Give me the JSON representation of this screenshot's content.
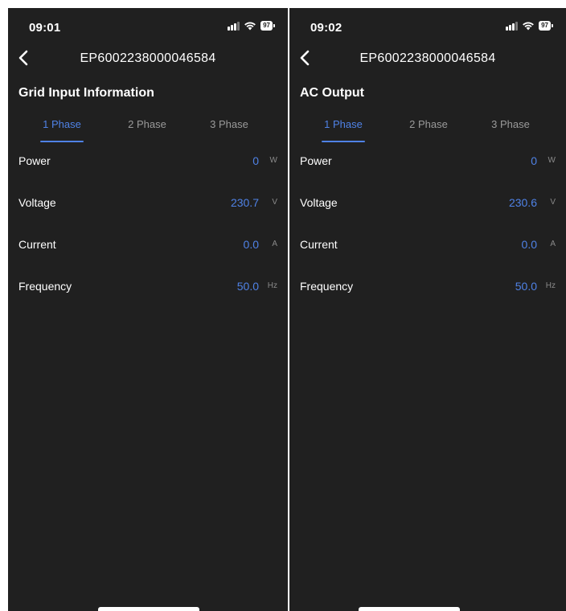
{
  "screens": [
    {
      "time": "09:01",
      "battery": "97",
      "title": "EP6002238000046584",
      "section": "Grid Input Information",
      "tabs": [
        "1 Phase",
        "2 Phase",
        "3 Phase"
      ],
      "active_tab": "1 Phase",
      "rows": [
        {
          "label": "Power",
          "value": "0",
          "unit": "W"
        },
        {
          "label": "Voltage",
          "value": "230.7",
          "unit": "V"
        },
        {
          "label": "Current",
          "value": "0.0",
          "unit": "A"
        },
        {
          "label": "Frequency",
          "value": "50.0",
          "unit": "Hz"
        }
      ]
    },
    {
      "time": "09:02",
      "battery": "97",
      "title": "EP6002238000046584",
      "section": "AC Output",
      "tabs": [
        "1 Phase",
        "2 Phase",
        "3 Phase"
      ],
      "active_tab": "1 Phase",
      "rows": [
        {
          "label": "Power",
          "value": "0",
          "unit": "W"
        },
        {
          "label": "Voltage",
          "value": "230.6",
          "unit": "V"
        },
        {
          "label": "Current",
          "value": "0.0",
          "unit": "A"
        },
        {
          "label": "Frequency",
          "value": "50.0",
          "unit": "Hz"
        }
      ]
    }
  ],
  "colors": {
    "background": "#202020",
    "accent": "#4f82e6",
    "text": "#ffffff",
    "muted": "#9a9a9a"
  },
  "icons": [
    "back-chevron-icon",
    "signal-icon",
    "wifi-icon",
    "battery-icon"
  ]
}
